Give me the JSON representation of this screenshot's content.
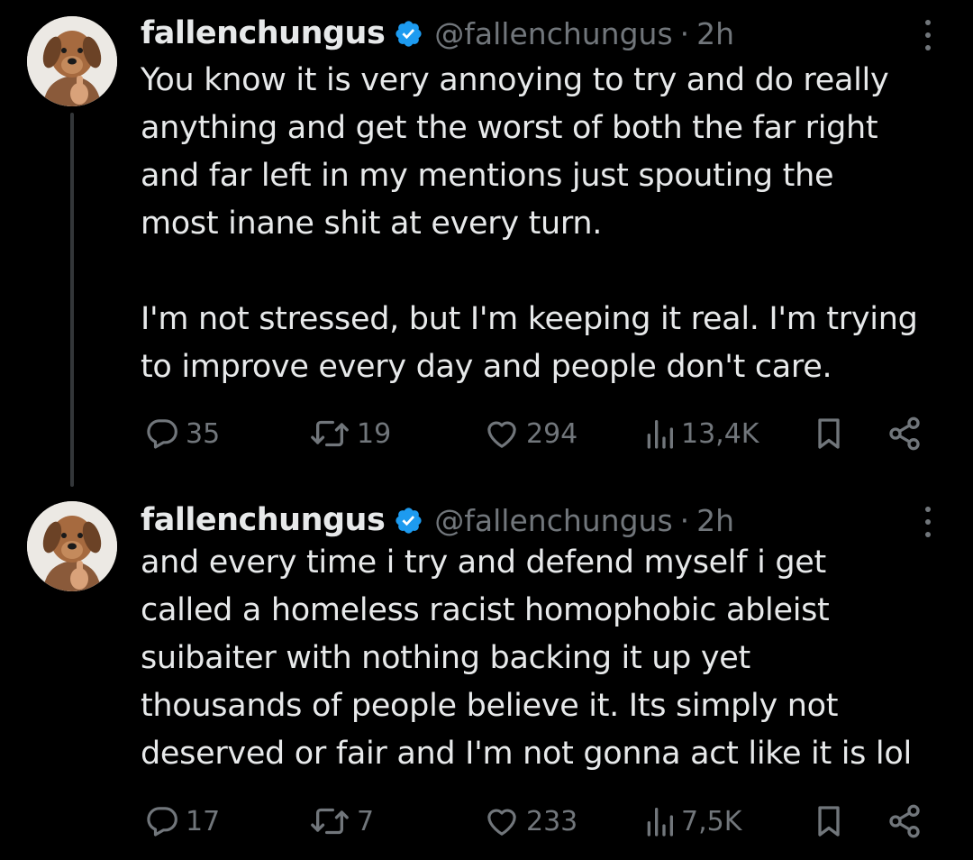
{
  "colors": {
    "background": "#000000",
    "text_primary": "#e7e9ea",
    "text_secondary": "#71767b",
    "verified_badge": "#1d9bf0",
    "thread_line": "#333639"
  },
  "tweets": [
    {
      "author": {
        "name": "fallenchungus",
        "handle": "@fallenchungus",
        "avatar_icon": "dog-avatar",
        "verified_icon": "verified-badge-icon"
      },
      "separator": "·",
      "time": "2h",
      "text_lines": [
        "You know it is very annoying to try and do really",
        "anything and get the worst of both the far right",
        "and far left in my mentions just spouting the",
        "most inane shit at every turn.",
        "",
        "I'm not stressed, but I'm keeping it real. I'm trying",
        "to improve every day and people don't care."
      ],
      "actions": {
        "replies": "35",
        "retweets": "19",
        "likes": "294",
        "views": "13,4K"
      }
    },
    {
      "author": {
        "name": "fallenchungus",
        "handle": "@fallenchungus",
        "avatar_icon": "dog-avatar",
        "verified_icon": "verified-badge-icon"
      },
      "separator": "·",
      "time": "2h",
      "text_lines": [
        "and every time i try and defend myself i get",
        "called a homeless racist homophobic ableist",
        "suibaiter with nothing backing it up yet",
        "thousands of people believe it. Its simply not",
        "deserved or fair and I'm not gonna act like it is lol"
      ],
      "actions": {
        "replies": "17",
        "retweets": "7",
        "likes": "233",
        "views": "7,5K"
      }
    }
  ]
}
